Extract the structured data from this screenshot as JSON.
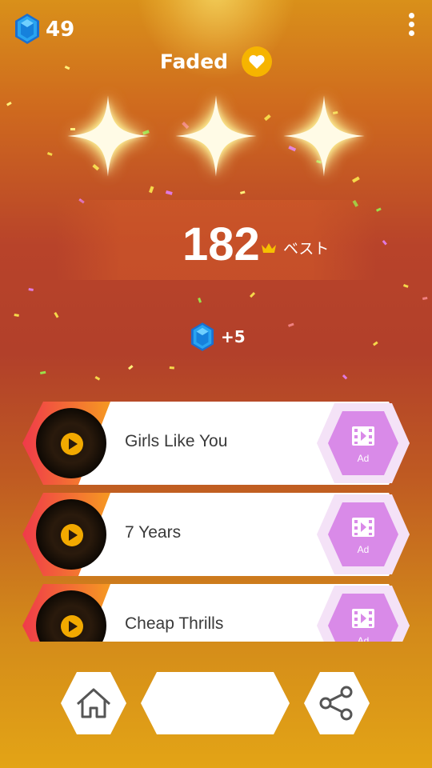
{
  "header": {
    "gem_count": "49",
    "song_title": "Faded"
  },
  "result": {
    "stars_earned": 3,
    "stars_total": 3,
    "score": "182",
    "best_label": "ベスト",
    "gem_reward": "+5"
  },
  "songs": [
    {
      "name": "Girls Like You",
      "ad_label": "Ad"
    },
    {
      "name": "7 Years",
      "ad_label": "Ad"
    },
    {
      "name": "Cheap Thrills",
      "ad_label": "Ad"
    }
  ],
  "icons": {
    "gem": "gem-icon",
    "menu": "more-vert-icon",
    "heart": "heart-icon",
    "star": "star-icon",
    "crown": "crown-icon",
    "play": "play-icon",
    "video_ad": "video-ad-icon",
    "home": "home-icon",
    "share": "share-icon"
  },
  "colors": {
    "gem": "#1e90e6",
    "heart_bg": "#f6b400",
    "play": "#f2a900",
    "ad_hex": "#d98ae8",
    "row_accent_left": "#f03a4a",
    "row_accent_right": "#f6a21e"
  }
}
